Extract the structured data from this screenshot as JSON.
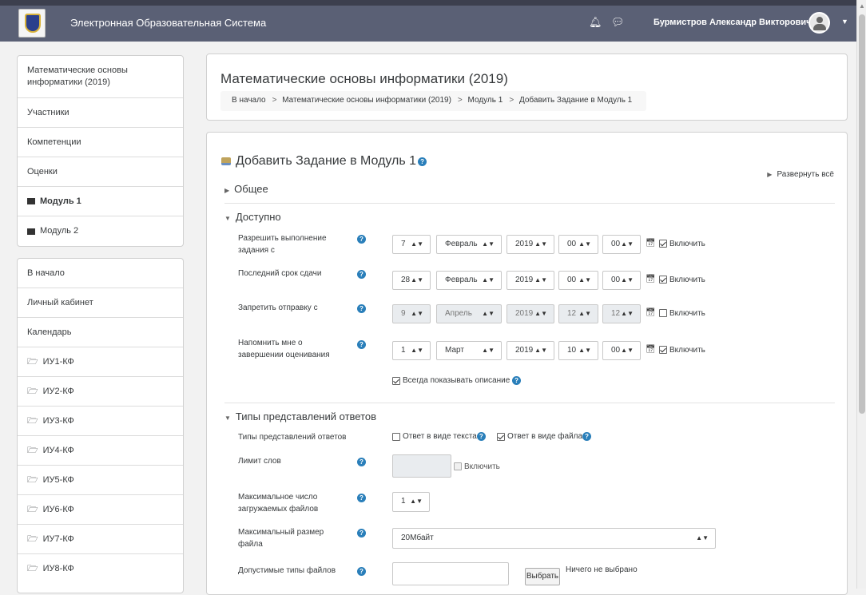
{
  "header": {
    "site_title": "Электронная Образовательная Система",
    "user_name": "Бурмистров Александр Викторович"
  },
  "course_nav": [
    {
      "label": "Математические основы информатики (2019)",
      "tall": true
    },
    {
      "label": "Участники"
    },
    {
      "label": "Компетенции"
    },
    {
      "label": "Оценки"
    },
    {
      "label": "Модуль 1",
      "bold": true,
      "icon": "flag-icon"
    },
    {
      "label": "Модуль 2",
      "icon": "flag-icon"
    }
  ],
  "site_nav": [
    {
      "label": "В начало"
    },
    {
      "label": "Личный кабинет"
    },
    {
      "label": "Календарь"
    },
    {
      "label": "ИУ1-КФ",
      "icon": "folder-icon"
    },
    {
      "label": "ИУ2-КФ",
      "icon": "folder-icon"
    },
    {
      "label": "ИУ3-КФ",
      "icon": "folder-icon"
    },
    {
      "label": "ИУ4-КФ",
      "icon": "folder-icon"
    },
    {
      "label": "ИУ5-КФ",
      "icon": "folder-icon"
    },
    {
      "label": "ИУ6-КФ",
      "icon": "folder-icon"
    },
    {
      "label": "ИУ7-КФ",
      "icon": "folder-icon"
    },
    {
      "label": "ИУ8-КФ",
      "icon": "folder-icon"
    }
  ],
  "page": {
    "heading": "Математические основы информатики (2019)",
    "breadcrumb": [
      "В начало",
      "Математические основы информатики (2019)",
      "Модуль 1",
      "Добавить Задание в Модуль 1"
    ]
  },
  "form": {
    "heading": "Добавить Задание в Модуль 1",
    "expand_all": "Развернуть всё",
    "section_general": "Общее",
    "section_availability": "Доступно",
    "section_submission": "Типы представлений ответов",
    "enable_label": "Включить",
    "date_rows": [
      {
        "label": "Разрешить выполнение задания с",
        "day": "7",
        "month": "Февраль",
        "year": "2019",
        "hour": "00",
        "minute": "00",
        "enabled": true,
        "disabled": false
      },
      {
        "label": "Последний срок сдачи",
        "day": "28",
        "month": "Февраль",
        "year": "2019",
        "hour": "00",
        "minute": "00",
        "enabled": true,
        "disabled": false
      },
      {
        "label": "Запретить отправку с",
        "day": "9",
        "month": "Апрель",
        "year": "2019",
        "hour": "12",
        "minute": "12",
        "enabled": false,
        "disabled": true
      },
      {
        "label": "Напомнить мне о завершении оценивания",
        "day": "1",
        "month": "Март",
        "year": "2019",
        "hour": "10",
        "minute": "00",
        "enabled": true,
        "disabled": false
      }
    ],
    "always_show_description": "Всегда показывать описание",
    "submission_types_label": "Типы представлений ответов",
    "online_text_label": "Ответ в виде текста",
    "online_text_checked": false,
    "file_submission_label": "Ответ в виде файла",
    "file_submission_checked": true,
    "word_limit_label": "Лимит слов",
    "word_limit_value": "",
    "word_limit_enable": "Включить",
    "max_files_label": "Максимальное число загружаемых файлов",
    "max_files_value": "1",
    "max_size_label": "Максимальный размер файла",
    "max_size_value": "20Мбайт",
    "file_types_label": "Допустимые типы файлов",
    "choose_button": "Выбрать",
    "nothing_selected": "Ничего не выбрано"
  }
}
